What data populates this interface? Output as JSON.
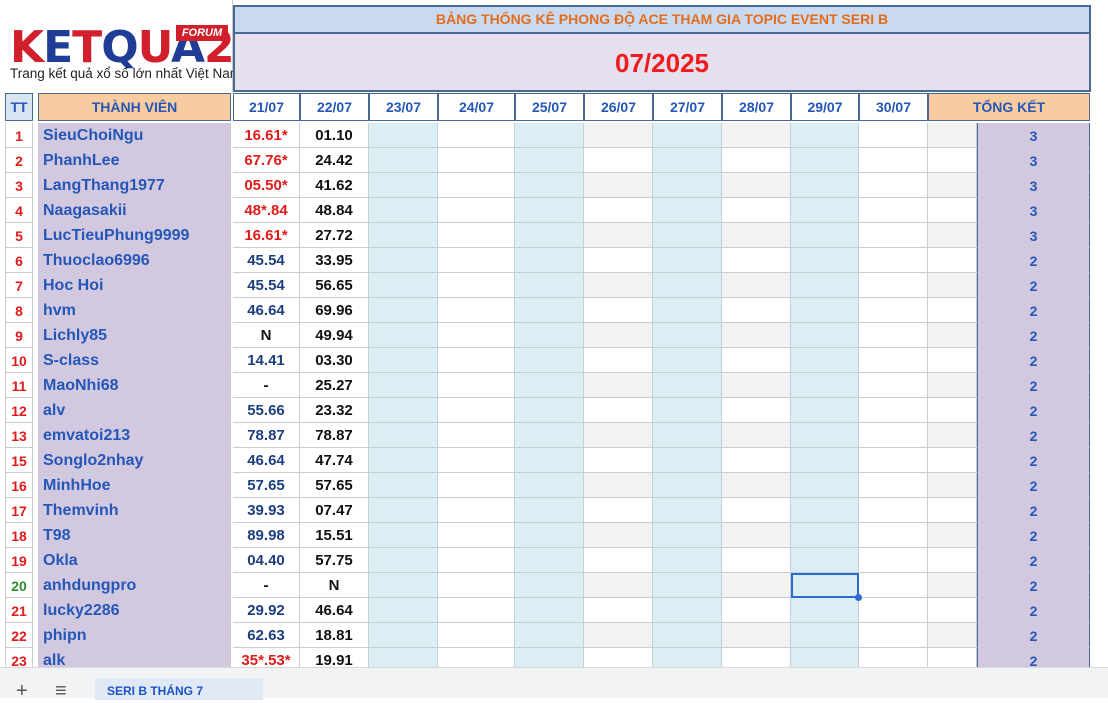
{
  "logo": {
    "letters": [
      "K",
      "E",
      "T",
      "Q",
      "U",
      "A",
      "2"
    ],
    "colors": [
      "#d11f2b",
      "#1f3c96",
      "#d11f2b",
      "#1f3c96",
      "#d11f2b",
      "#1f3c96",
      "#d11f2b"
    ],
    "badge": "FORUM",
    "tagline": "Trang kết quả xổ số lớn nhất Việt Nam"
  },
  "banner": {
    "title": "BẢNG THỐNG KÊ PHONG ĐỘ ACE THAM GIA TOPIC EVENT SERI B",
    "month": "07/2025"
  },
  "headers": {
    "tt": "TT",
    "member": "THÀNH VIÊN",
    "dates": [
      "21/07",
      "22/07",
      "23/07",
      "24/07",
      "25/07",
      "26/07",
      "27/07",
      "28/07",
      "29/07",
      "30/07"
    ],
    "total": "TỔNG KẾT"
  },
  "rows": [
    {
      "tt": "1",
      "name": "SieuChoiNgu",
      "d1": "16.61*",
      "d1_red": true,
      "d2": "01.10",
      "total": "3"
    },
    {
      "tt": "2",
      "name": "PhanhLee",
      "d1": "67.76*",
      "d1_red": true,
      "d2": "24.42",
      "total": "3"
    },
    {
      "tt": "3",
      "name": "LangThang1977",
      "d1": "05.50*",
      "d1_red": true,
      "d2": "41.62",
      "total": "3"
    },
    {
      "tt": "4",
      "name": "Naagasakii",
      "d1": "48*.84",
      "d1_red": true,
      "d2": "48.84",
      "total": "3"
    },
    {
      "tt": "5",
      "name": "LucTieuPhung9999",
      "d1": "16.61*",
      "d1_red": true,
      "d2": "27.72",
      "total": "3"
    },
    {
      "tt": "6",
      "name": "Thuoclao6996",
      "d1": "45.54",
      "d1_red": false,
      "d2": "33.95",
      "total": "2"
    },
    {
      "tt": "7",
      "name": "Hoc Hoi",
      "d1": "45.54",
      "d1_red": false,
      "d2": "56.65",
      "total": "2"
    },
    {
      "tt": "8",
      "name": "hvm",
      "d1": "46.64",
      "d1_red": false,
      "d2": "69.96",
      "total": "2"
    },
    {
      "tt": "9",
      "name": "Lichly85",
      "d1": "N",
      "d1_red": false,
      "d2": "49.94",
      "total": "2"
    },
    {
      "tt": "10",
      "name": "S-class",
      "d1": "14.41",
      "d1_red": false,
      "d2": "03.30",
      "total": "2"
    },
    {
      "tt": "11",
      "name": "MaoNhi68",
      "d1": "-",
      "d1_red": false,
      "d2": "25.27",
      "total": "2"
    },
    {
      "tt": "12",
      "name": "alv",
      "d1": "55.66",
      "d1_red": false,
      "d2": "23.32",
      "total": "2"
    },
    {
      "tt": "13",
      "name": "emvatoi213",
      "d1": "78.87",
      "d1_red": false,
      "d2": "78.87",
      "total": "2"
    },
    {
      "tt": "15",
      "name": "Songlo2nhay",
      "d1": "46.64",
      "d1_red": false,
      "d2": "47.74",
      "total": "2"
    },
    {
      "tt": "16",
      "name": "MinhHoe",
      "d1": "57.65",
      "d1_red": false,
      "d2": "57.65",
      "total": "2"
    },
    {
      "tt": "17",
      "name": "Themvinh",
      "d1": "39.93",
      "d1_red": false,
      "d2": "07.47",
      "total": "2"
    },
    {
      "tt": "18",
      "name": "T98",
      "d1": "89.98",
      "d1_red": false,
      "d2": "15.51",
      "total": "2"
    },
    {
      "tt": "19",
      "name": "Okla",
      "d1": "04.40",
      "d1_red": false,
      "d2": "57.75",
      "total": "2"
    },
    {
      "tt": "20",
      "name": "anhdungpro",
      "d1": "-",
      "d1_red": false,
      "d2": "N",
      "total": "2"
    },
    {
      "tt": "21",
      "name": "lucky2286",
      "d1": "29.92",
      "d1_red": false,
      "d2": "46.64",
      "total": "2"
    },
    {
      "tt": "22",
      "name": "phipn",
      "d1": "62.63",
      "d1_red": false,
      "d2": "18.81",
      "total": "2"
    },
    {
      "tt": "23",
      "name": "alk",
      "d1": "35*.53*",
      "d1_red": true,
      "d2": "19.91",
      "total": "2"
    }
  ],
  "tabs": {
    "add": "+",
    "list": "≡",
    "sheet": "SERI B THÁNG 7"
  },
  "colors": {
    "header_orange": "#f8cba0",
    "member_lilac": "#d2c8e0",
    "col_teal": "#daeef3",
    "col_grey": "#f2f2f2",
    "border_blue": "#4a6a96",
    "selection_blue": "#2d6bd1"
  }
}
